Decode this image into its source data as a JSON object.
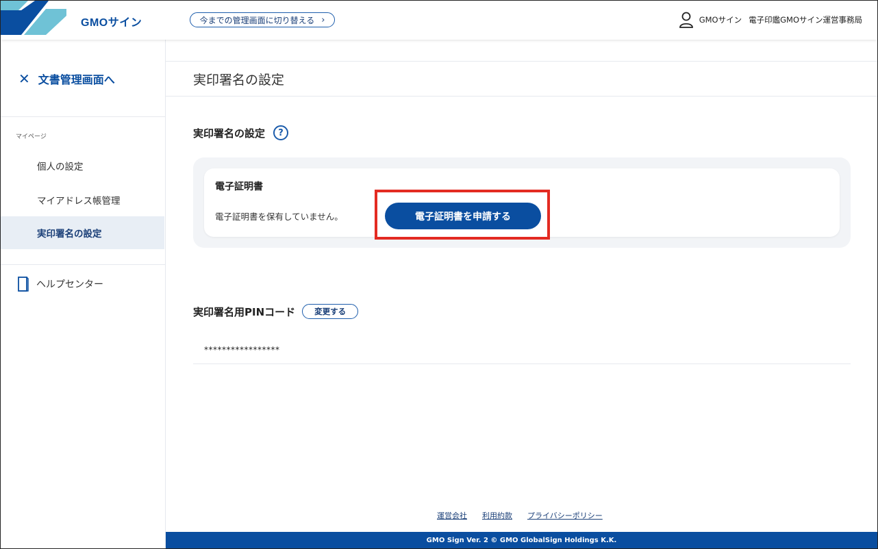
{
  "header": {
    "logo_text": "GMOサイン",
    "switch_button_label": "今までの管理画面に切り替える",
    "switch_chevron": "›",
    "user_name": "GMOサイン",
    "org_name": "電子印鑑GMOサイン運営事務局",
    "icons": {
      "user": "user-icon",
      "logo": "logo-mark-icon",
      "chevron": "chevron-right-icon"
    }
  },
  "sidebar": {
    "back_label": "文書管理画面へ",
    "back_icon_glyph": "✕",
    "section_label": "マイページ",
    "items": [
      {
        "label": "個人の設定",
        "active": false
      },
      {
        "label": "マイアドレス帳管理",
        "active": false
      },
      {
        "label": "実印署名の設定",
        "active": true
      }
    ],
    "help_label": "ヘルプセンター"
  },
  "main": {
    "page_title": "実印署名の設定",
    "section_title": "実印署名の設定",
    "help_glyph": "?",
    "certificate": {
      "heading": "電子証明書",
      "status": "電子証明書を保有していません。",
      "apply_button": "電子証明書を申請する"
    },
    "pin": {
      "title": "実印署名用PINコード",
      "change_button": "変更する",
      "value": "*****************"
    }
  },
  "footer": {
    "links": [
      "運営会社",
      "利用約款",
      "プライバシーポリシー"
    ],
    "copyright": "GMO Sign Ver. 2  © GMO GlobalSign Holdings K.K."
  },
  "colors": {
    "brand_blue": "#0a4ea0",
    "highlight_red": "#e32b22",
    "logo_light": "#6fc2d6"
  }
}
